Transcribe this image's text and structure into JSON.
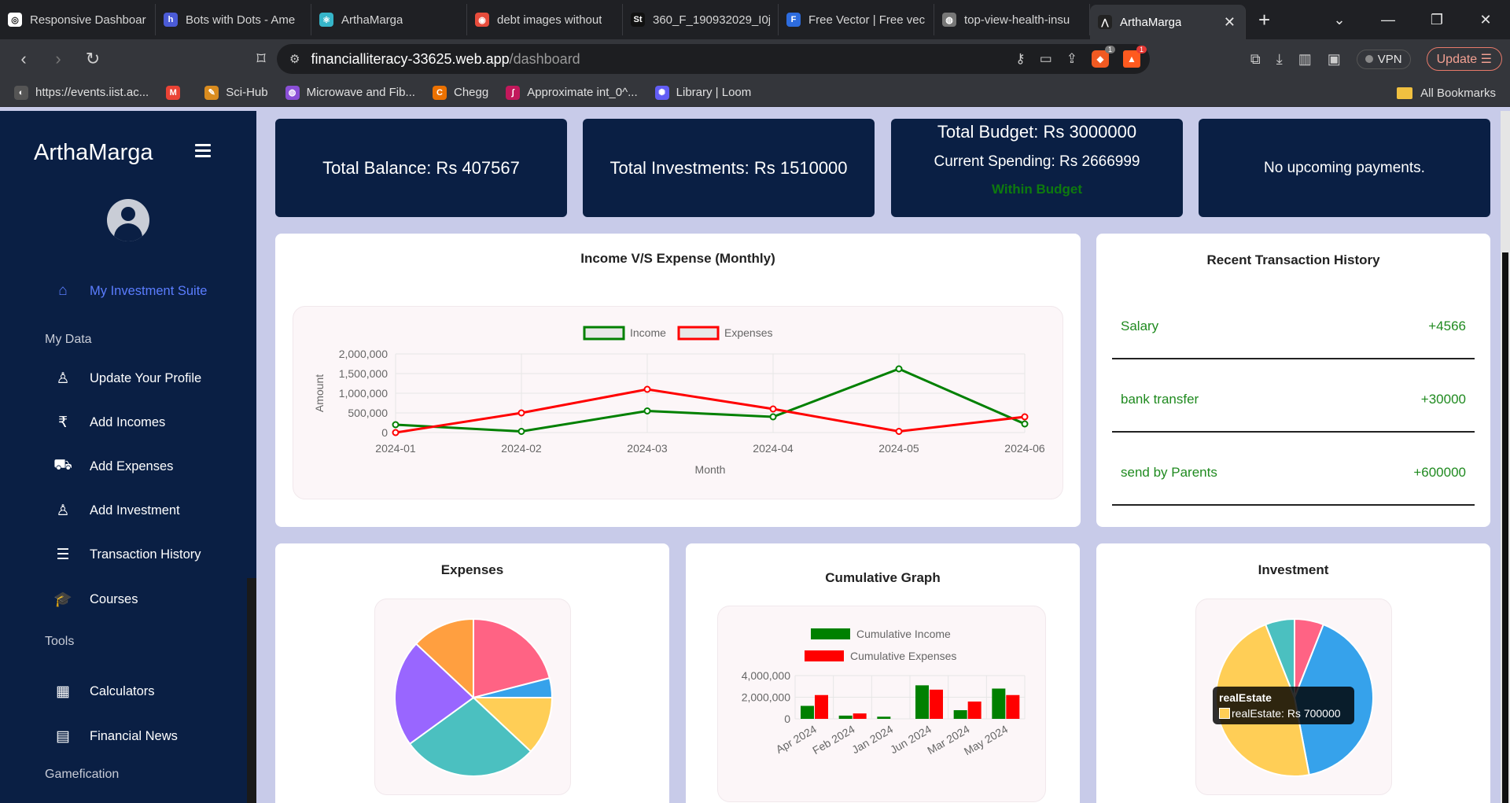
{
  "browser": {
    "tabs": [
      {
        "title": "Responsive Dashboar",
        "color": "#ffffff",
        "glyph": "◎"
      },
      {
        "title": "Bots with Dots - Ame",
        "color": "#4b5bd6",
        "glyph": "h"
      },
      {
        "title": "ArthaMarga",
        "color": "#36b5c9",
        "glyph": "⚛"
      },
      {
        "title": "debt images without",
        "color": "#e74c3c",
        "glyph": "◉"
      },
      {
        "title": "360_F_190932029_I0j",
        "color": "#111111",
        "glyph": "St"
      },
      {
        "title": "Free Vector | Free vec",
        "color": "#2d6cdf",
        "glyph": "F"
      },
      {
        "title": "top-view-health-insu",
        "color": "#777777",
        "glyph": "◍"
      },
      {
        "title": "ArthaMarga",
        "color": "#222222",
        "glyph": "⋀"
      }
    ],
    "new_tab": "+",
    "url_host": "financialliteracy-33625.web.app",
    "url_path": "/dashboard",
    "vpn_label": "VPN",
    "update_label": "Update",
    "shield_count": "1",
    "alert_count": "1",
    "bookmarks": [
      {
        "label": "https://events.iist.ac...",
        "color": "#555555",
        "glyph": "◐"
      },
      {
        "label": "",
        "color": "#ea4335",
        "glyph": "M"
      },
      {
        "label": "Sci-Hub",
        "color": "#d98c1f",
        "glyph": "✎"
      },
      {
        "label": "Microwave and Fib...",
        "color": "#8a4fd6",
        "glyph": "◍"
      },
      {
        "label": "Chegg",
        "color": "#eb7100",
        "glyph": "C"
      },
      {
        "label": "Approximate int_0^...",
        "color": "#c2185b",
        "glyph": "∫"
      },
      {
        "label": "Library | Loom",
        "color": "#625df5",
        "glyph": "✺"
      }
    ],
    "all_bookmarks": "All Bookmarks"
  },
  "sidebar": {
    "brand": "ArthaMarga",
    "active_item": {
      "label": "My Investment Suite",
      "icon": "home-icon"
    },
    "sections": [
      {
        "title": "My Data",
        "items": [
          {
            "label": "Update Your Profile",
            "icon": "user-icon"
          },
          {
            "label": "Add Incomes",
            "icon": "rupee-icon"
          },
          {
            "label": "Add Expenses",
            "icon": "cart-plus-icon"
          },
          {
            "label": "Add Investment",
            "icon": "user-icon"
          },
          {
            "label": "Transaction History",
            "icon": "list-icon"
          },
          {
            "label": "Courses",
            "icon": "graduation-cap-icon"
          }
        ]
      },
      {
        "title": "Tools",
        "items": [
          {
            "label": "Calculators",
            "icon": "calculator-icon"
          },
          {
            "label": "Financial News",
            "icon": "newspaper-icon"
          }
        ]
      },
      {
        "title": "Gamefication",
        "items": []
      }
    ]
  },
  "stats": {
    "balance": "Total Balance: Rs 407567",
    "investments": "Total Investments: Rs 1510000",
    "budget": "Total Budget: Rs 3000000",
    "spending": "Current Spending: Rs 2666999",
    "budget_status": "Within Budget",
    "payments": "No upcoming payments."
  },
  "income_chart": {
    "card_title": "Income V/S Expense (Monthly)",
    "chart_data": {
      "type": "line",
      "x": [
        "2024-01",
        "2024-02",
        "2024-03",
        "2024-04",
        "2024-05",
        "2024-06"
      ],
      "series": [
        {
          "name": "Income",
          "color": "#008000",
          "values": [
            200000,
            30000,
            550000,
            400000,
            1620000,
            220000
          ]
        },
        {
          "name": "Expenses",
          "color": "#ff0000",
          "values": [
            0,
            500000,
            1100000,
            600000,
            30000,
            400000
          ]
        }
      ],
      "xlabel": "Month",
      "ylabel": "Amount",
      "ylim": [
        0,
        2000000
      ],
      "yticks": [
        "2,000,000",
        "1,500,000",
        "1,000,000",
        "500,000",
        "0"
      ],
      "legend": "top"
    }
  },
  "transactions": {
    "title": "Recent Transaction History",
    "items": [
      {
        "label": "Salary",
        "amount": "+4566"
      },
      {
        "label": "bank transfer",
        "amount": "+30000"
      },
      {
        "label": "send by Parents",
        "amount": "+600000"
      }
    ]
  },
  "expenses_chart": {
    "card_title": "Expenses",
    "chart_data": {
      "type": "pie",
      "values": [
        21,
        4,
        12,
        28,
        22,
        13
      ],
      "colors": [
        "#ff6384",
        "#36a2eb",
        "#ffce56",
        "#4bc0c0",
        "#9966ff",
        "#ff9f40"
      ]
    }
  },
  "cumulative_chart": {
    "card_title": "Cumulative Graph",
    "chart_data": {
      "type": "bar",
      "categories": [
        "Apr 2024",
        "Feb 2024",
        "Jan 2024",
        "Jun 2024",
        "Mar 2024",
        "May 2024"
      ],
      "series": [
        {
          "name": "Cumulative Income",
          "color": "#008000",
          "values": [
            1200000,
            300000,
            200000,
            3100000,
            800000,
            2800000
          ]
        },
        {
          "name": "Cumulative Expenses",
          "color": "#ff0000",
          "values": [
            2200000,
            500000,
            0,
            2700000,
            1600000,
            2200000
          ]
        }
      ],
      "yticks": [
        "4,000,000",
        "2,000,000",
        "0"
      ],
      "ylim": [
        0,
        4000000
      ],
      "legend": "top"
    }
  },
  "investment_chart": {
    "card_title": "Investment",
    "chart_data": {
      "type": "pie",
      "values": [
        6,
        41,
        47,
        6
      ],
      "colors": [
        "#ff6384",
        "#36a2eb",
        "#ffce56",
        "#4bc0c0"
      ]
    },
    "tooltip": {
      "title": "realEstate",
      "text": "realEstate: Rs 700000"
    }
  }
}
